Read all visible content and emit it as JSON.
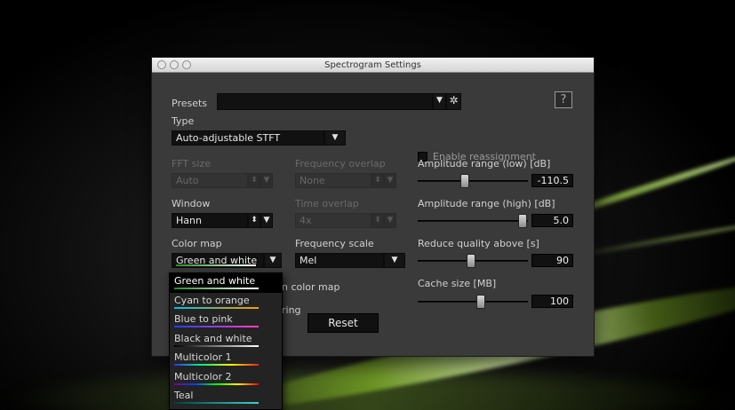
{
  "window": {
    "title": "Spectrogram Settings"
  },
  "presets": {
    "label": "Presets",
    "value": ""
  },
  "help": {
    "label": "?"
  },
  "type": {
    "label": "Type",
    "value": "Auto-adjustable STFT"
  },
  "reassignment": {
    "label": "Enable reassignment"
  },
  "fft_size": {
    "label": "FFT size",
    "value": "Auto"
  },
  "frequency_overlap": {
    "label": "Frequency overlap",
    "value": "None"
  },
  "window_fn": {
    "label": "Window",
    "value": "Hann"
  },
  "time_overlap": {
    "label": "Time overlap",
    "value": "4x"
  },
  "color_map": {
    "label": "Color map",
    "value": "Green and white"
  },
  "frequency_scale": {
    "label": "Frequency scale",
    "value": "Mel"
  },
  "amp_low": {
    "label": "Amplitude range (low)  [dB]",
    "value": "-110.5",
    "level": 0.5
  },
  "amp_high": {
    "label": "Amplitude range (high)  [dB]",
    "value": "5.0",
    "level": 0.97
  },
  "reduce_quality": {
    "label": "Reduce quality above [s]",
    "value": "90",
    "level": 0.5
  },
  "cache_size": {
    "label": "Cache size [MB]",
    "value": "100",
    "level": 0.58
  },
  "partial": {
    "color_map_text": "n color map",
    "smoothing_text": "ring"
  },
  "reset": {
    "label": "Reset"
  },
  "colormap_options": [
    {
      "label": "Green and white",
      "colors": "#2a8a2a,#ffffff"
    },
    {
      "label": "Cyan to orange",
      "colors": "#00c0e0,#ff9900"
    },
    {
      "label": "Blue to pink",
      "colors": "#2040ff,#ff40c0"
    },
    {
      "label": "Black and white",
      "colors": "#000000,#ffffff"
    },
    {
      "label": "Multicolor 1",
      "colors": "#3030ff,#00ff80,#ffff00,#ff2020"
    },
    {
      "label": "Multicolor 2",
      "colors": "#800080,#0040ff,#00ff00,#ffff00,#ff0000"
    },
    {
      "label": "Teal",
      "colors": "#004040,#40d0d0"
    }
  ],
  "icons": {
    "dropdown": "chevron-down-icon",
    "gear": "gear-icon",
    "stepper": "stepper-icon"
  }
}
